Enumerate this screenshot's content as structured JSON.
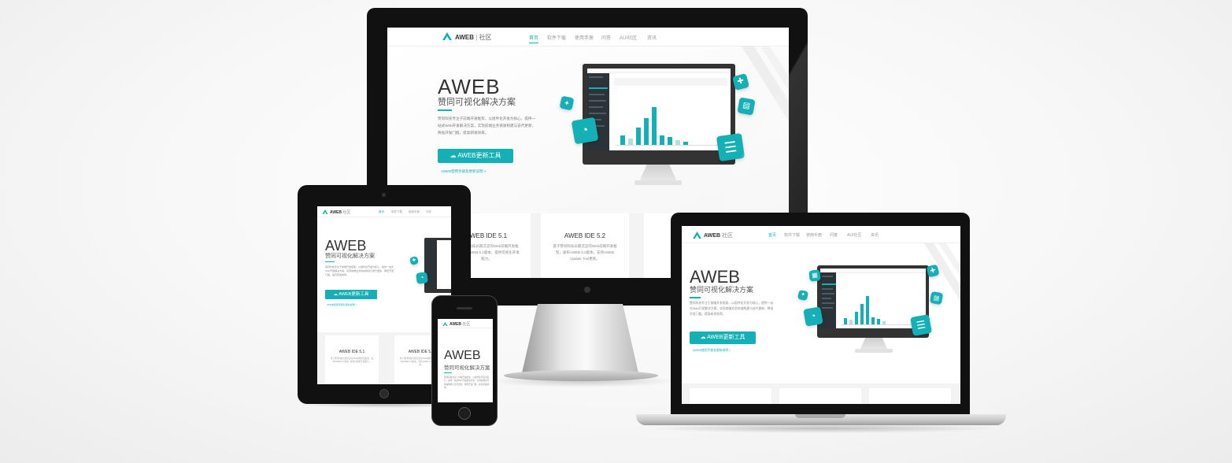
{
  "brand": {
    "logo_text": "AWEB",
    "logo_suffix": "社区",
    "accent_color": "#14b0b6"
  },
  "nav": {
    "items": [
      "首页",
      "软件下载",
      "使用手册",
      "问答",
      "AUI社区",
      "资讯"
    ]
  },
  "hero": {
    "title": "AWEB",
    "subtitle": "赞同可视化解决方案",
    "description": "赞同科技专注于前端开发框架，以组件化开发为核心，提供一站式Web开发解决方案，实现前端业务快速构建与迭代更新，降低开发门槛，提高研发效率。",
    "button_label": "AWEB更新工具",
    "button_icon": "cloud-download-icon",
    "link_text": "AWEB使用手册及更新说明 >"
  },
  "cards": [
    {
      "title": "AWEB IDE 5.1",
      "desc": "基于赞同科技长期沉淀的Web前端开发框架，发布AWEB 5.1版本，提供可视化开发能力。"
    },
    {
      "title": "AWEB IDE 5.2",
      "desc": "基于赞同科技长期沉淀的Web前端开发框架，发布AWEB 5.2版本，支持AWEB Update Tool更新。"
    },
    {
      "title": "",
      "desc": ""
    }
  ],
  "floating_icons": [
    "puzzle-icon",
    "gauge-icon",
    "dashboard-icon",
    "layout-icon",
    "chart-icon",
    "list-icon"
  ]
}
